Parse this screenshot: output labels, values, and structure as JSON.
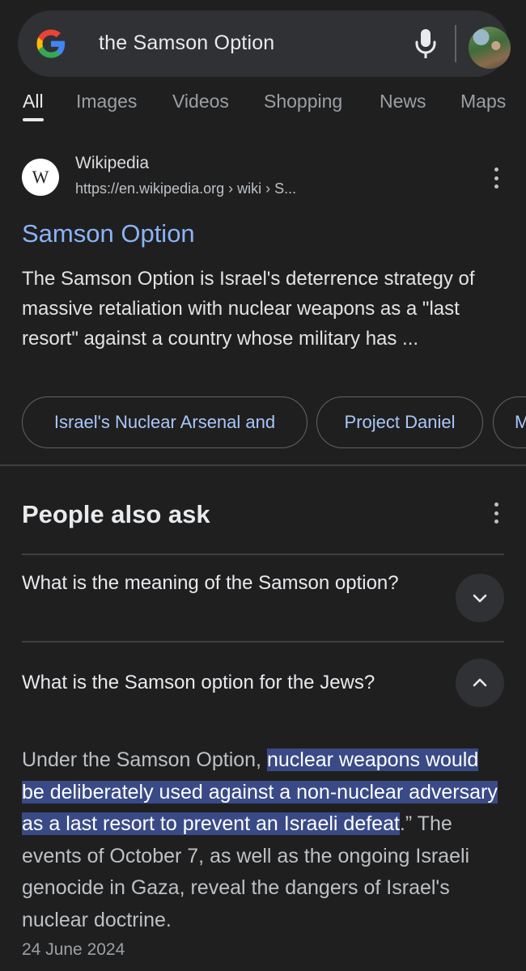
{
  "search": {
    "query": "the Samson Option",
    "icons": {
      "logo": "google-g-icon",
      "voice": "mic-icon",
      "profile": "avatar"
    }
  },
  "tabs": [
    "All",
    "Images",
    "Videos",
    "Shopping",
    "News",
    "Maps"
  ],
  "result": {
    "site_letter": "W",
    "site_name": "Wikipedia",
    "url": "https://en.wikipedia.org › wiki › S...",
    "title": "Samson Option",
    "snippet": "The Samson Option is Israel's deterrence strategy of massive retaliation with nuclear weapons as a \"last resort\" against a country whose military has ...",
    "chips": [
      "Israel's Nuclear Arsenal and",
      "Project Daniel",
      "M"
    ]
  },
  "people_also_ask": {
    "title": "People also ask",
    "questions": [
      {
        "text": "What is the meaning of the Samson option?",
        "expanded": false
      },
      {
        "text": "What is the Samson option for the Jews?",
        "expanded": true
      }
    ],
    "answer": {
      "prefix": "Under the Samson Option, ",
      "highlight": "nuclear weapons would be deliberately used against a non-nuclear adversary as a last resort to prevent an Israeli defeat",
      "suffix": ".” The events of October 7, as well as the ongoing Israeli genocide in Gaza, reveal the dangers of Israel's nuclear doctrine.",
      "date": "24 June 2024"
    }
  },
  "colors": {
    "background": "#1f1f1f",
    "link": "#8ab4f8",
    "chip_text": "#a8c7fa",
    "highlight": "#394a86"
  }
}
